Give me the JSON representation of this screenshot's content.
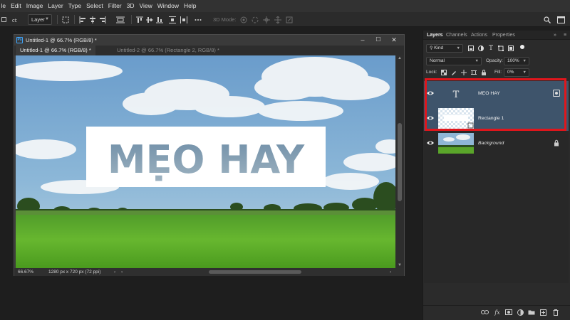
{
  "menu": [
    "le",
    "Edit",
    "Image",
    "Layer",
    "Type",
    "Select",
    "Filter",
    "3D",
    "View",
    "Window",
    "Help"
  ],
  "options_bar": {
    "auto_select_value": "Layer",
    "mode_3d_label": "3D Mode:"
  },
  "document": {
    "window_title": "Untitled-1 @ 66.7% (RGB/8) *",
    "tabs": [
      {
        "label": "Untitled-1 @ 66.7% (RGB/8) *",
        "active": true
      },
      {
        "label": "Untitled-2 @ 66.7% (Rectangle 2, RGB/8) *",
        "active": false
      }
    ],
    "canvas_text": "MẸO HAY",
    "status_zoom": "66.67%",
    "status_info": "1280 px x 720 px (72 ppi)"
  },
  "panel": {
    "tabs": [
      "Layers",
      "Channels",
      "Actions",
      "Properties"
    ],
    "filter_kind": "Kind",
    "blend_mode": "Normal",
    "opacity_label": "Opacity:",
    "opacity_value": "100%",
    "lock_label": "Lock:",
    "fill_label": "Fill:",
    "fill_value": "0%",
    "layers": [
      {
        "name": "MẸO HAY",
        "type": "text",
        "selected": true
      },
      {
        "name": "Rectangle 1",
        "type": "shape",
        "selected": true
      },
      {
        "name": "Background",
        "type": "image",
        "selected": false,
        "locked": true
      }
    ]
  },
  "colors": {
    "highlight": "#e0161c",
    "selected_layer": "#3e546b",
    "accent": "#3fa7ff"
  }
}
